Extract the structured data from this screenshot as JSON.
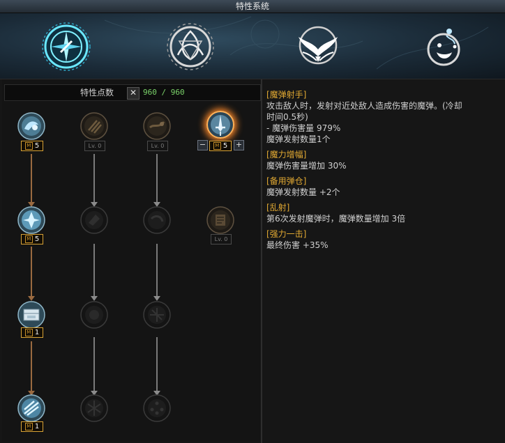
{
  "window": {
    "title": "特性系统"
  },
  "categories": [
    {
      "name": "compass-emblem-icon",
      "active": true
    },
    {
      "name": "triquetra-emblem-icon",
      "active": false
    },
    {
      "name": "wings-emblem-icon",
      "active": false
    },
    {
      "name": "flask-emblem-icon",
      "active": false
    }
  ],
  "points": {
    "label": "特性点数",
    "x_symbol": "✕",
    "value": "960 / 960"
  },
  "skills": {
    "c1r1": {
      "level": "5",
      "state": "active"
    },
    "c2r1": {
      "level": "Lv. 0",
      "state": "inactive"
    },
    "c3r1": {
      "level": "Lv. 0",
      "state": "inactive"
    },
    "c4r1": {
      "level": "5",
      "state": "selected",
      "minus": "−",
      "plus": "+"
    },
    "c1r2": {
      "level": "5",
      "state": "active"
    },
    "c2r2": {
      "state": "locked"
    },
    "c3r2": {
      "state": "locked"
    },
    "c4r2": {
      "level": "Lv. 0",
      "state": "inactive"
    },
    "c1r3": {
      "level": "1",
      "state": "active"
    },
    "c2r3": {
      "state": "locked"
    },
    "c3r3": {
      "state": "locked"
    },
    "c1r4": {
      "level": "1",
      "state": "active"
    },
    "c2r4": {
      "state": "locked"
    },
    "c3r4": {
      "state": "locked"
    }
  },
  "badge_letter": "M",
  "description": {
    "s1": {
      "title": "[魔弹射手]",
      "l1": "攻击敌人时，发射对近处敌人造成伤害的魔弹。(冷却",
      "l2": "时间0.5秒)",
      "l3": "- 魔弹伤害量 979%",
      "l4": "魔弹发射数量1个"
    },
    "s2": {
      "title": "[魔力增幅]",
      "l1": "魔弹伤害量增加 30%"
    },
    "s3": {
      "title": "[备用弹仓]",
      "l1": "魔弹发射数量 +2个"
    },
    "s4": {
      "title": "[乱射]",
      "l1": "第6次发射魔弹时，魔弹数量增加 3倍"
    },
    "s5": {
      "title": "[强力一击]",
      "l1": "最终伤害 +35%"
    }
  },
  "colors": {
    "accent": "#e0a832",
    "points": "#7bd36a",
    "active_border": "#d9a336",
    "selected_glow": "#ff8a2a"
  }
}
